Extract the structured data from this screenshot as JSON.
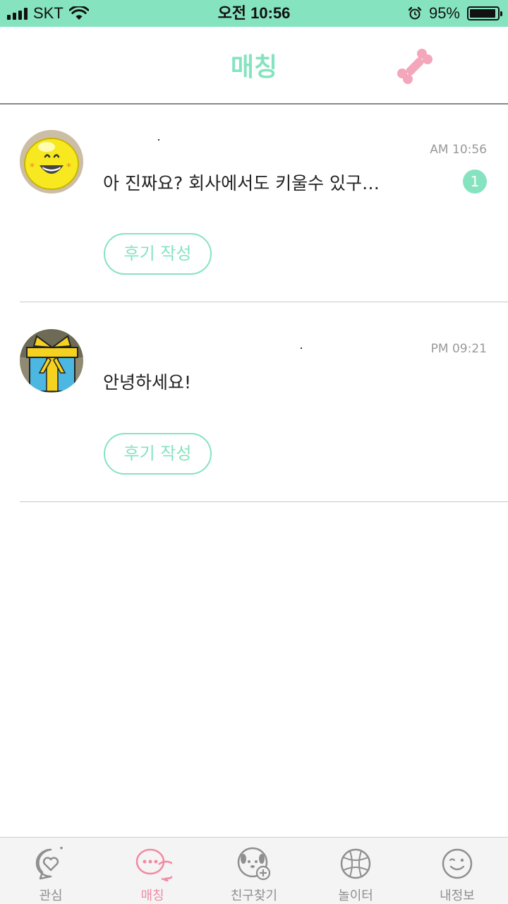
{
  "status_bar": {
    "carrier": "SKT",
    "time": "오전 10:56",
    "battery_percent": "95%",
    "battery_level": 0.95,
    "icons": [
      "signal-icon",
      "wifi-icon",
      "alarm-icon",
      "battery-icon"
    ]
  },
  "header": {
    "title": "매칭",
    "right_icon": "bone-icon"
  },
  "chats": [
    {
      "time": "AM 10:56",
      "message": "아 진짜요? 회사에서도 키울수 있구…",
      "unread": "1",
      "review_label": "후기 작성",
      "avatar_icon": "yellow-smiley-avatar"
    },
    {
      "time": "PM 09:21",
      "message": "안녕하세요!",
      "review_label": "후기 작성",
      "avatar_icon": "gift-box-avatar"
    }
  ],
  "tabs": [
    {
      "label": "관심",
      "icon": "heart-bubble-icon",
      "active": false
    },
    {
      "label": "매칭",
      "icon": "chat-bubbles-icon",
      "active": true
    },
    {
      "label": "친구찾기",
      "icon": "dog-add-icon",
      "active": false
    },
    {
      "label": "놀이터",
      "icon": "ball-icon",
      "active": false
    },
    {
      "label": "내정보",
      "icon": "face-icon",
      "active": false
    }
  ],
  "colors": {
    "accent": "#86e3c0",
    "active_tab": "#f08aa3",
    "bone": "#f4a6bb"
  }
}
